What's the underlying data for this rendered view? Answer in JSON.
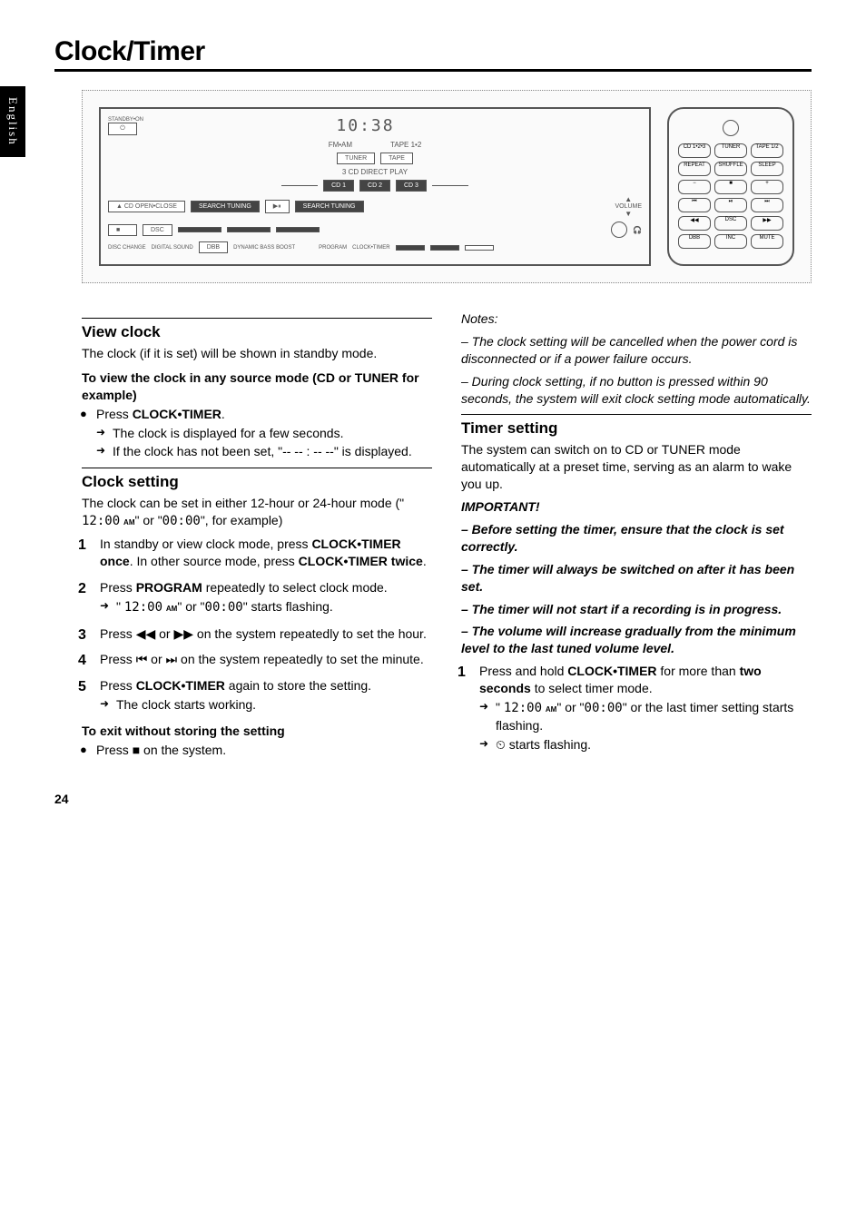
{
  "lang_tab": "English",
  "page_title": "Clock/Timer",
  "page_number": "24",
  "device": {
    "standby_label": "STANDBY•ON",
    "lcd_time": "10:38",
    "fm_am": "FM•AM",
    "tape12": "TAPE 1•2",
    "tuner": "TUNER",
    "tape": "TAPE",
    "direct": "3 CD DIRECT PLAY",
    "cd1": "CD 1",
    "cd2": "CD 2",
    "cd3": "CD 3",
    "open": "CD OPEN•CLOSE",
    "search": "SEARCH TUNING",
    "volume": "VOLUME",
    "dsc": "DSC",
    "disc": "DISC CHANGE",
    "dds": "DIGITAL SOUND",
    "dbb": "DBB",
    "bass": "DYNAMIC BASS BOOST",
    "prog": "PROGRAM",
    "clk": "CLOCK•TIMER"
  },
  "remote": {
    "r1a": "CD 1•2•3",
    "r1b": "TUNER",
    "r1c": "TAPE 1/2",
    "r2a": "REPEAT",
    "r2b": "SHUFFLE",
    "r2c": "SLEEP",
    "vol_minus": "−",
    "vol_stop": "■",
    "vol_plus": "+",
    "prev": "⏮",
    "play": "⏯",
    "next": "⏭",
    "rew": "◀◀",
    "dsc": "DSC",
    "ff": "▶▶",
    "b1": "DBB",
    "b2": "INC",
    "b3": "MUTE"
  },
  "left": {
    "view_clock_h": "View clock",
    "view_clock_p": "The clock (if it is set) will be shown in standby mode.",
    "to_view_sub": "To view the clock in any source mode (CD or TUNER for example)",
    "press_ct": "Press CLOCK•TIMER.",
    "arrow_displayed": "The clock is displayed for a few seconds.",
    "arrow_notset": "If the clock has not been set, \"-- -- : -- --\" is displayed.",
    "clock_setting_h": "Clock setting",
    "clock_setting_p": "The clock can be set in either 12-hour or 24-hour mode (\" 12:00 AM\" or \"00:00\", for example)",
    "step1": "In standby or view clock mode, press CLOCK•TIMER once.  In other source mode, press CLOCK•TIMER twice.",
    "step2": "Press PROGRAM repeatedly to select clock mode.",
    "step2_arrow": "\" 12:00 AM\" or \"00:00\" starts flashing.",
    "step3": "Press ◀◀ or ▶▶ on the system repeatedly to set the hour.",
    "step4": "Press ⏮ or ⏭ on the system repeatedly to set the minute.",
    "step5": "Press CLOCK•TIMER again to store the setting.",
    "step5_arrow": "The clock starts working.",
    "exit_sub": "To exit without storing the setting",
    "exit_bullet": "Press ■ on the system."
  },
  "right": {
    "notes_h": "Notes:",
    "note1": "– The clock setting will be cancelled when the power cord is disconnected or if a power failure occurs.",
    "note2": "– During clock setting, if no button is pressed within 90 seconds, the system will exit clock setting mode automatically.",
    "timer_h": "Timer setting",
    "timer_p": "The system can switch on to CD or TUNER mode automatically at a preset time, serving as an alarm to wake you up.",
    "important_h": "IMPORTANT!",
    "imp1": "– Before setting the timer, ensure that the clock is set correctly.",
    "imp2": "– The timer will always be switched on after it has been set.",
    "imp3": "– The timer will not start if a recording is in progress.",
    "imp4": "– The volume will increase gradually from the minimum level to the last tuned volume level.",
    "t_step1": "Press and hold CLOCK•TIMER for more than two seconds to select timer mode.",
    "t_step1_arrow1": "\" 12:00 AM\" or \"00:00\" or the last timer setting starts flashing.",
    "t_step1_arrow2": "⏲ starts flashing."
  }
}
